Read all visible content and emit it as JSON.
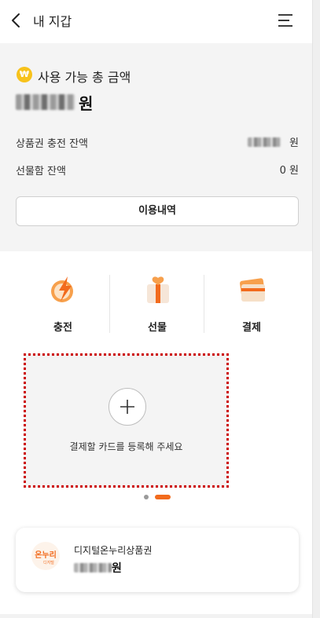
{
  "header": {
    "title": "내 지갑",
    "back_icon": "chevron-left-icon",
    "menu_icon": "hamburger-menu-icon"
  },
  "balance": {
    "currency_icon": "won-coin-icon",
    "currency_symbol": "₩",
    "available_label": "사용 가능 총 금액",
    "total_unit": "원",
    "rows": [
      {
        "label": "상품권 충전 잔액",
        "value": "",
        "unit": "원"
      },
      {
        "label": "선물함 잔액",
        "value": "0",
        "unit": "원"
      }
    ],
    "history_button": "이용내역"
  },
  "actions": [
    {
      "label": "충전",
      "icon": "lightning-charge-icon"
    },
    {
      "label": "선물",
      "icon": "gift-box-icon"
    },
    {
      "label": "결제",
      "icon": "payment-card-icon"
    }
  ],
  "card_register": {
    "text": "결제할 카드를 등록해 주세요",
    "icon": "plus-icon"
  },
  "pager": {
    "count": 2,
    "active_index": 1
  },
  "voucher": {
    "name": "디지털온누리상품권",
    "unit": "원",
    "logo_icon": "onnuri-logo-icon",
    "logo_text": "온누리",
    "logo_subtext": "디지털"
  },
  "colors": {
    "accent": "#f26b1d",
    "coin": "#f7c21b",
    "section_bg": "#f4f4f4",
    "highlight_border": "#cc0000"
  }
}
